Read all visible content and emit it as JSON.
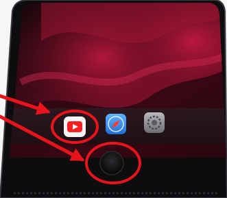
{
  "photo": {
    "subject": "smartphone-home-screen",
    "background_color": "#f6f6f6",
    "phone_body_color": "#0d0d10",
    "screen_colors": [
      "#14080f",
      "#5a0e22",
      "#b3163a",
      "#2a0610"
    ],
    "annotation_color": "#e8141c"
  },
  "dock": {
    "apps": [
      {
        "icon": "youtube-icon",
        "color": "#ff1f1f",
        "highlighted": true
      },
      {
        "icon": "safari-icon",
        "color": "#2f8cf0",
        "highlighted": false
      },
      {
        "icon": "settings-icon",
        "color": "#8e8e93",
        "highlighted": false
      }
    ]
  },
  "annotations": {
    "highlighted_targets": [
      "youtube-icon",
      "home-button"
    ]
  }
}
